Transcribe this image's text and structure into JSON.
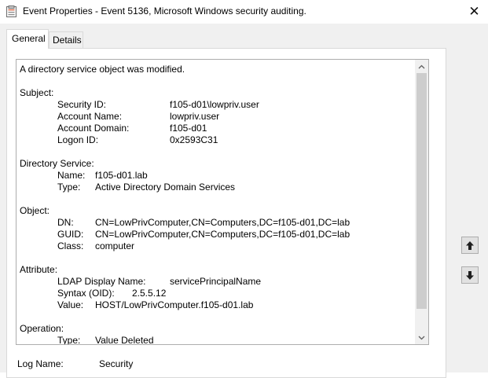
{
  "window": {
    "title": "Event Properties - Event 5136, Microsoft Windows security auditing.",
    "close_glyph": "✕"
  },
  "tabs": [
    {
      "label": "General",
      "selected": true
    },
    {
      "label": "Details",
      "selected": false
    }
  ],
  "description": {
    "intro": "A directory service object was modified.",
    "subject": {
      "heading": "Subject:",
      "fields": [
        {
          "key": "Security ID:",
          "value": "f105-d01\\lowpriv.user"
        },
        {
          "key": "Account Name:",
          "value": "lowpriv.user"
        },
        {
          "key": "Account Domain:",
          "value": "f105-d01"
        },
        {
          "key": "Logon ID:",
          "value": "0x2593C31"
        }
      ]
    },
    "directory_service": {
      "heading": "Directory Service:",
      "fields": [
        {
          "key": "Name:",
          "value": "f105-d01.lab"
        },
        {
          "key": "Type:",
          "value": "Active Directory Domain Services"
        }
      ]
    },
    "object": {
      "heading": "Object:",
      "fields": [
        {
          "key": "DN:",
          "value": "CN=LowPrivComputer,CN=Computers,DC=f105-d01,DC=lab"
        },
        {
          "key": "GUID:",
          "value": "CN=LowPrivComputer,CN=Computers,DC=f105-d01,DC=lab"
        },
        {
          "key": "Class:",
          "value": "computer"
        }
      ]
    },
    "attribute": {
      "heading": "Attribute:",
      "fields": [
        {
          "key": "LDAP Display Name:",
          "value": "servicePrincipalName"
        },
        {
          "key": "Syntax (OID):",
          "value": "2.5.5.12"
        },
        {
          "key": "Value:",
          "value": "HOST/LowPrivComputer.f105-d01.lab"
        }
      ]
    },
    "operation": {
      "heading": "Operation:",
      "fields": [
        {
          "key": "Type:",
          "value": "Value Deleted"
        }
      ]
    }
  },
  "log_name": {
    "label": "Log Name:",
    "value": "Security"
  },
  "icons": {
    "app": "event-viewer-icon",
    "scroll_up": "chevron-up-icon",
    "scroll_down": "chevron-down-icon",
    "prev_event": "arrow-up-icon",
    "next_event": "arrow-down-icon"
  },
  "colors": {
    "window_bg": "#ffffff",
    "client_bg": "#f0f0f0",
    "border": "#adadad",
    "scroll_thumb": "#cdcdcd"
  }
}
